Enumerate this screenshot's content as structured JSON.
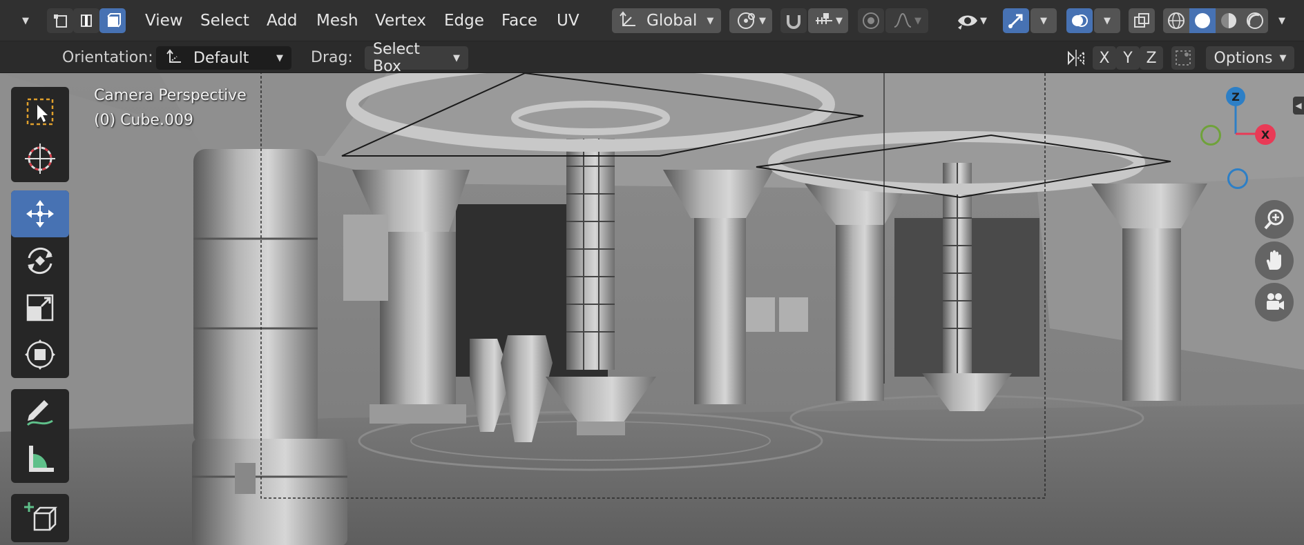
{
  "header": {
    "menu": [
      "View",
      "Select",
      "Add",
      "Mesh",
      "Vertex",
      "Edge",
      "Face",
      "UV"
    ],
    "transform_orientation": "Global",
    "select_modes": [
      "vertex-select",
      "edge-select",
      "face-select"
    ],
    "active_select_mode": "face-select"
  },
  "tool_settings": {
    "orientation_label": "Orientation:",
    "orientation_value": "Default",
    "drag_label": "Drag:",
    "drag_value": "Select Box",
    "axis_x": "X",
    "axis_y": "Y",
    "axis_z": "Z",
    "options_label": "Options"
  },
  "viewport": {
    "view_name": "Camera Perspective",
    "active_object": "(0) Cube.009"
  },
  "toolbar": {
    "tools": [
      "select-box",
      "cursor",
      "move",
      "rotate",
      "scale",
      "transform",
      "annotate",
      "measure",
      "add-cube"
    ],
    "active_tool": "move"
  },
  "gizmo": {
    "z_label": "Z",
    "x_label": "X"
  },
  "colors": {
    "accent": "#4772b3",
    "header_bg": "#303030",
    "axis_x": "#e93a56",
    "axis_y": "#6fa23a",
    "axis_z": "#2d7fc6"
  }
}
